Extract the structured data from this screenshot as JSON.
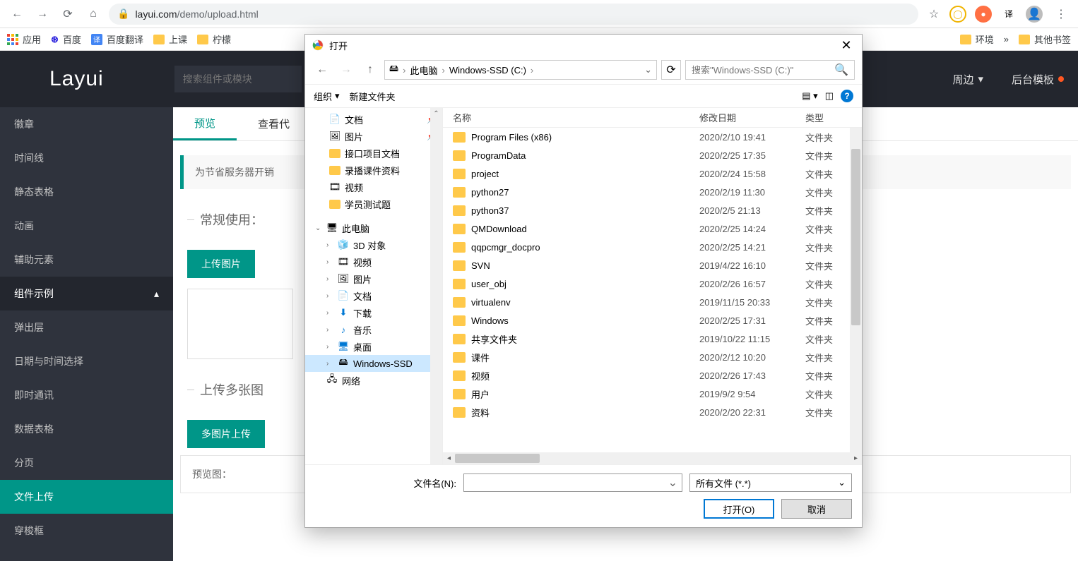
{
  "browser": {
    "url_domain": "layui.com",
    "url_path": "/demo/upload.html"
  },
  "bookmarks": {
    "apps": "应用",
    "baidu": "百度",
    "baidu_translate": "百度翻译",
    "class": "上课",
    "lemon": "柠檬",
    "env": "环境",
    "more": "»",
    "other": "其他书签"
  },
  "header": {
    "logo": "Layui",
    "search_placeholder": "搜索组件或模块",
    "around": "周边",
    "admin_template": "后台模板"
  },
  "sidebar": {
    "items": [
      "徽章",
      "时间线",
      "静态表格",
      "动画",
      "辅助元素",
      "组件示例",
      "弹出层",
      "日期与时间选择",
      "即时通讯",
      "数据表格",
      "分页",
      "文件上传",
      "穿梭框"
    ]
  },
  "tabs": {
    "preview": "预览",
    "view_code": "查看代"
  },
  "content": {
    "notice": "为节省服务器开销",
    "section_normal": "常规使用：",
    "btn_upload_img": "上传图片",
    "section_multi": "上传多张图",
    "btn_multi": "多图片上传",
    "preview_label": "预览图："
  },
  "dialog": {
    "title": "打开",
    "path": {
      "pc": "此电脑",
      "drive": "Windows-SSD (C:)"
    },
    "search_placeholder": "搜索\"Windows-SSD (C:)\"",
    "toolbar": {
      "organize": "组织",
      "new_folder": "新建文件夹"
    },
    "tree": {
      "docs": "文档",
      "pics": "图片",
      "api_docs": "接口项目文档",
      "rec_materials": "录播课件资料",
      "video": "视频",
      "student_tests": "学员测试题",
      "this_pc": "此电脑",
      "3d": "3D 对象",
      "video2": "视频",
      "pics2": "图片",
      "docs2": "文档",
      "download": "下载",
      "music": "音乐",
      "desktop": "桌面",
      "ssd": "Windows-SSD",
      "network": "网络"
    },
    "columns": {
      "name": "名称",
      "date": "修改日期",
      "type": "类型"
    },
    "files": [
      {
        "name": "Program Files (x86)",
        "date": "2020/2/10 19:41",
        "type": "文件夹"
      },
      {
        "name": "ProgramData",
        "date": "2020/2/25 17:35",
        "type": "文件夹"
      },
      {
        "name": "project",
        "date": "2020/2/24 15:58",
        "type": "文件夹"
      },
      {
        "name": "python27",
        "date": "2020/2/19 11:30",
        "type": "文件夹"
      },
      {
        "name": "python37",
        "date": "2020/2/5 21:13",
        "type": "文件夹"
      },
      {
        "name": "QMDownload",
        "date": "2020/2/25 14:24",
        "type": "文件夹"
      },
      {
        "name": "qqpcmgr_docpro",
        "date": "2020/2/25 14:21",
        "type": "文件夹"
      },
      {
        "name": "SVN",
        "date": "2019/4/22 16:10",
        "type": "文件夹"
      },
      {
        "name": "user_obj",
        "date": "2020/2/26 16:57",
        "type": "文件夹"
      },
      {
        "name": "virtualenv",
        "date": "2019/11/15 20:33",
        "type": "文件夹"
      },
      {
        "name": "Windows",
        "date": "2020/2/25 17:31",
        "type": "文件夹"
      },
      {
        "name": "共享文件夹",
        "date": "2019/10/22 11:15",
        "type": "文件夹"
      },
      {
        "name": "课件",
        "date": "2020/2/12 10:20",
        "type": "文件夹"
      },
      {
        "name": "视频",
        "date": "2020/2/26 17:43",
        "type": "文件夹"
      },
      {
        "name": "用户",
        "date": "2019/9/2 9:54",
        "type": "文件夹"
      },
      {
        "name": "资料",
        "date": "2020/2/20 22:31",
        "type": "文件夹"
      }
    ],
    "filename_label": "文件名(N):",
    "filter": "所有文件 (*.*)",
    "open": "打开(O)",
    "cancel": "取消"
  }
}
